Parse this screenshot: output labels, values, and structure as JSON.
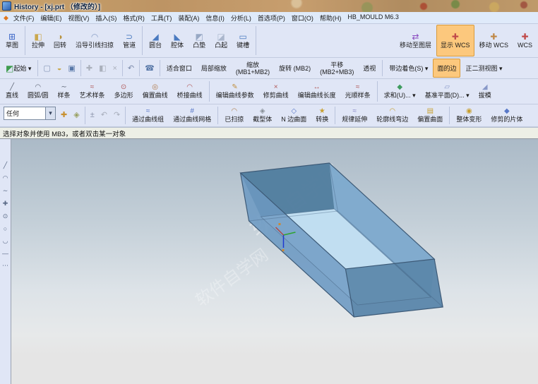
{
  "window": {
    "title": "History - [xj.prt （修改的）]"
  },
  "menu": {
    "items": [
      "文件(F)",
      "编辑(E)",
      "视图(V)",
      "插入(S)",
      "格式(R)",
      "工具(T)",
      "装配(A)",
      "信息(I)",
      "分析(L)",
      "首选项(P)",
      "窗口(O)",
      "帮助(H)",
      "HB_MOULD M6.3"
    ]
  },
  "toolbars": {
    "row1": [
      {
        "label": "草图",
        "icon": "⊞",
        "iconColor": "#3e68c8"
      },
      {
        "label": "拉伸",
        "icon": "◧",
        "iconColor": "#caa84e",
        "sep": true
      },
      {
        "label": "回转",
        "icon": "◑",
        "iconColor": "#b8923e"
      },
      {
        "label": "沿导引线扫掠",
        "icon": "◠",
        "iconColor": "#8aa0c8"
      },
      {
        "label": "管道",
        "icon": "⊃",
        "iconColor": "#4a7ac0"
      },
      {
        "label": "圆台",
        "icon": "◢",
        "iconColor": "#4a7ac0",
        "sep": true
      },
      {
        "label": "腔体",
        "icon": "◣",
        "iconColor": "#4a7ac0"
      },
      {
        "label": "凸垫",
        "icon": "◩",
        "iconColor": "#97a8c4"
      },
      {
        "label": "凸起",
        "icon": "◪",
        "iconColor": "#aab6cc"
      },
      {
        "label": "键槽",
        "icon": "▭",
        "iconColor": "#4a7ac0"
      },
      {
        "label": "移动至图层",
        "icon": "⇄",
        "iconColor": "#8a4ac0",
        "sep": true,
        "cls": "push"
      },
      {
        "label": "显示 WCS",
        "icon": "✚",
        "iconColor": "#c04a4a",
        "highlight": true
      },
      {
        "label": "移动 WCS",
        "icon": "✚",
        "iconColor": "#c08a4a"
      },
      {
        "label": "WCS",
        "icon": "✚",
        "iconColor": "#c04a4a"
      }
    ],
    "row2": [
      {
        "label": "起始 ▾",
        "icon": "◩",
        "iconColor": "#3f9c4f"
      },
      {
        "label": "",
        "icon": "▢",
        "iconColor": "#8898b8",
        "cls": "ico",
        "sep": true
      },
      {
        "label": "",
        "icon": "◒",
        "iconColor": "#c8a84e",
        "cls": "ico"
      },
      {
        "label": "",
        "icon": "▣",
        "iconColor": "#5878a8",
        "cls": "ico"
      },
      {
        "label": "",
        "icon": "✚",
        "iconColor": "#aab0bc",
        "cls": "ico",
        "sep": true
      },
      {
        "label": "",
        "icon": "◧",
        "iconColor": "#aab0bc",
        "cls": "ico"
      },
      {
        "label": "",
        "icon": "×",
        "iconColor": "#aab0bc",
        "cls": "ico"
      },
      {
        "label": "",
        "icon": "↶",
        "iconColor": "#7888a8",
        "cls": "ico",
        "sep": true
      },
      {
        "label": "",
        "icon": "☎",
        "iconColor": "#5878a8",
        "cls": "ico",
        "sep": true
      },
      {
        "label": "适合窗口",
        "sep": true
      },
      {
        "label": "局部缩放"
      },
      {
        "label": "缩放\n(MB1+MB2)"
      },
      {
        "label": "旋转 (MB2)"
      },
      {
        "label": "平移\n(MB2+MB3)"
      },
      {
        "label": "透视"
      },
      {
        "label": "带边着色(S) ▾",
        "sep": true
      },
      {
        "label": "面的边",
        "highlight": true
      },
      {
        "label": "正二测视图 ▾"
      }
    ],
    "row3": [
      {
        "label": "直线",
        "icon": "╱",
        "iconColor": "#606878"
      },
      {
        "label": "圆弧/圆",
        "icon": "◠",
        "iconColor": "#606878"
      },
      {
        "label": "样条",
        "icon": "∼",
        "iconColor": "#606878"
      },
      {
        "label": "艺术样条",
        "icon": "≈",
        "iconColor": "#b05858"
      },
      {
        "label": "多边形",
        "icon": "⊙",
        "iconColor": "#b05858"
      },
      {
        "label": "偏置曲线",
        "icon": "◎",
        "iconColor": "#b07848"
      },
      {
        "label": "桥接曲线",
        "icon": "◠",
        "iconColor": "#b05858"
      },
      {
        "label": "编辑曲线参数",
        "icon": "✎",
        "iconColor": "#c09040",
        "sep": true
      },
      {
        "label": "修剪曲线",
        "icon": "×",
        "iconColor": "#b05858"
      },
      {
        "label": "编辑曲线长度",
        "icon": "↔",
        "iconColor": "#b05858"
      },
      {
        "label": "光顺样条",
        "icon": "≈",
        "iconColor": "#b05858"
      },
      {
        "label": "求和(U)... ▾",
        "icon": "◆",
        "iconColor": "#3f9c5f",
        "sep": true
      },
      {
        "label": "基准平面(D)... ▾",
        "icon": "▱",
        "iconColor": "#8898c8"
      },
      {
        "label": "拔模",
        "icon": "◢",
        "iconColor": "#8898c8"
      }
    ],
    "row4": [
      {
        "label": "",
        "icon": "✚",
        "iconColor": "#c89030",
        "cls": "ico"
      },
      {
        "label": "",
        "icon": "◈",
        "iconColor": "#98a060",
        "cls": "ico"
      },
      {
        "label": "",
        "icon": "±",
        "iconColor": "#8890a8",
        "cls": "ico",
        "sep": true
      },
      {
        "label": "",
        "icon": "↶",
        "iconColor": "#a8aebc",
        "cls": "ico"
      },
      {
        "label": "",
        "icon": "↷",
        "iconColor": "#a8aebc",
        "cls": "ico"
      },
      {
        "label": "通过曲线组",
        "icon": "≈",
        "iconColor": "#5878c8",
        "sep": true
      },
      {
        "label": "通过曲线网格",
        "icon": "#",
        "iconColor": "#5878c8"
      },
      {
        "label": "已扫掠",
        "icon": "◠",
        "iconColor": "#b08050",
        "sep": true
      },
      {
        "label": "截型体",
        "icon": "◈",
        "iconColor": "#889098"
      },
      {
        "label": "N 边曲面",
        "icon": "◇",
        "iconColor": "#5878c8"
      },
      {
        "label": "转换",
        "icon": "★",
        "iconColor": "#c8a030"
      },
      {
        "label": "规律延伸",
        "icon": "≈",
        "iconColor": "#8888c8",
        "sep": true
      },
      {
        "label": "轮廓线弯边",
        "icon": "◠",
        "iconColor": "#c8a030"
      },
      {
        "label": "偏置曲面",
        "icon": "▤",
        "iconColor": "#c8a030"
      },
      {
        "label": "整体变形",
        "icon": "◉",
        "iconColor": "#c8a030",
        "sep": true
      },
      {
        "label": "修剪的片体",
        "icon": "◆",
        "iconColor": "#5878c8"
      }
    ],
    "filter_value": "任何",
    "filter_caret": "▾"
  },
  "left_toolbar": {
    "icons": [
      "╱",
      "◠",
      "∼",
      "✚",
      "⊙",
      "○",
      "◡",
      "—",
      "⋯"
    ]
  },
  "prompt": {
    "text": "选择对象并使用 MB3，或者双击某一对象"
  },
  "viewport": {
    "watermark": "软件自学网"
  },
  "colors": {
    "highlight_orange": "#fcc87d",
    "toolbar_background": "#e0e6f6",
    "menubar_background": "#dfeafa",
    "viewport_top": "#abbac7",
    "viewport_bottom": "#e5e5e5",
    "box_fill": "#6e9ac2",
    "box_inner_bottom": "#c2dff2",
    "box_edge": "#3d5a77",
    "axis_red": "#b04848",
    "axis_green": "#2fa32f",
    "axis_blue": "#2038d0"
  }
}
